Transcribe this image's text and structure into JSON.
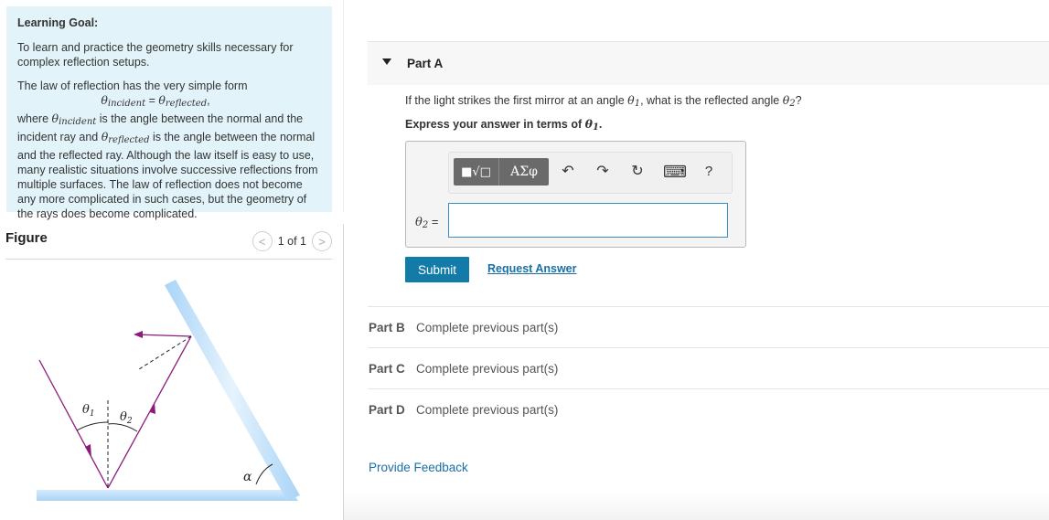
{
  "learning_goal": {
    "title": "Learning Goal:",
    "intro": "To learn and practice the geometry skills necessary for complex reflection setups.",
    "law_intro": "The law of reflection has the very simple form",
    "formula_left": "θ",
    "formula_left_sub": "incident",
    "formula_eq": " = ",
    "formula_right": "θ",
    "formula_right_sub": "reflected",
    "formula_end": ",",
    "where_1": "where ",
    "theta_inc": "θ",
    "theta_inc_sub": "incident",
    "where_2": " is the angle between the normal and the incident ray and ",
    "theta_ref": "θ",
    "theta_ref_sub": "reflected",
    "where_3": " is the angle between the normal and the reflected ray. Although the law itself is easy to use, many realistic situations involve successive reflections from multiple surfaces. The law of reflection does not become any more complicated in such cases, but the geometry of the rays does become complicated."
  },
  "figure": {
    "title": "Figure",
    "pager_text": "1 of 1",
    "prev_glyph": "<",
    "next_glyph": ">",
    "labels": {
      "theta1": "θ",
      "theta1_sub": "1",
      "theta2": "θ",
      "theta2_sub": "2",
      "alpha": "α"
    }
  },
  "partA": {
    "title": "Part A",
    "question_1": "If the light strikes the first mirror at an angle ",
    "question_theta1": "θ",
    "question_theta1_sub": "1",
    "question_2": ", what is the reflected angle ",
    "question_theta2": "θ",
    "question_theta2_sub": "2",
    "question_3": "?",
    "instruction_1": "Express your answer in terms of ",
    "instruction_theta": "θ",
    "instruction_theta_sub": "1",
    "instruction_end": ".",
    "toolbar": {
      "templates_label": "■√□",
      "symbols_label": "ΑΣφ",
      "undo_icon": "↶",
      "redo_icon": "↷",
      "reset_icon": "↻",
      "keyboard_icon": "⌨",
      "help_label": "?"
    },
    "eq_theta": "θ",
    "eq_sub": "2",
    "eq_sign": " =",
    "input_value": "",
    "submit_label": "Submit",
    "request_label": "Request Answer"
  },
  "other_parts": [
    {
      "label": "Part B",
      "status": "Complete previous part(s)"
    },
    {
      "label": "Part C",
      "status": "Complete previous part(s)"
    },
    {
      "label": "Part D",
      "status": "Complete previous part(s)"
    }
  ],
  "feedback_label": "Provide Feedback",
  "colors": {
    "accent": "#137ba7",
    "goal_bg": "#e2f4f9",
    "ray": "#8b1a7a",
    "mirror": "#bfe0fb"
  }
}
